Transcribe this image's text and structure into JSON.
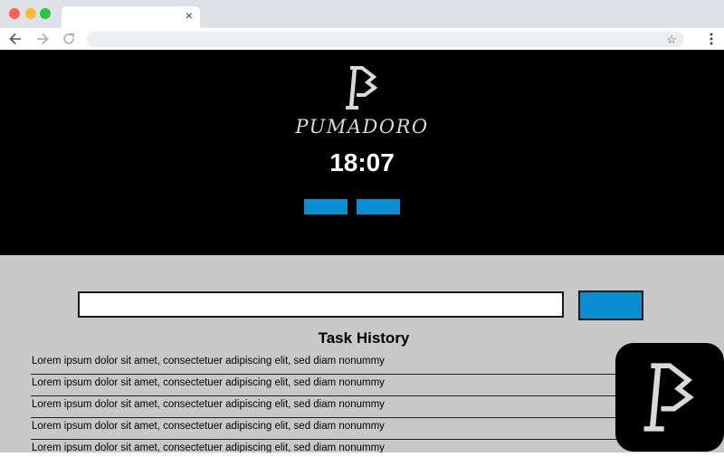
{
  "browser": {
    "tab_close": "×",
    "star": "☆",
    "icons": [
      "back-icon",
      "forward-icon",
      "reload-icon",
      "star-icon",
      "menu-icon"
    ]
  },
  "hero": {
    "brand": "PUMADORO",
    "timer": "18:07"
  },
  "task": {
    "input_value": "",
    "history_title": "Task History",
    "history": [
      "Lorem ipsum dolor sit amet, consectetuer adipiscing elit, sed diam nonummy",
      "Lorem ipsum dolor sit amet, consectetuer adipiscing elit, sed diam nonummy",
      "Lorem ipsum dolor sit amet, consectetuer adipiscing elit, sed diam nonummy",
      "Lorem ipsum dolor sit amet, consectetuer adipiscing elit, sed diam nonummy",
      "Lorem ipsum dolor sit amet, consectetuer adipiscing elit, sed diam nonummy"
    ]
  },
  "colors": {
    "accent": "#0a8ed1",
    "hero_bg": "#000000",
    "content_bg": "#c7c8c7"
  }
}
